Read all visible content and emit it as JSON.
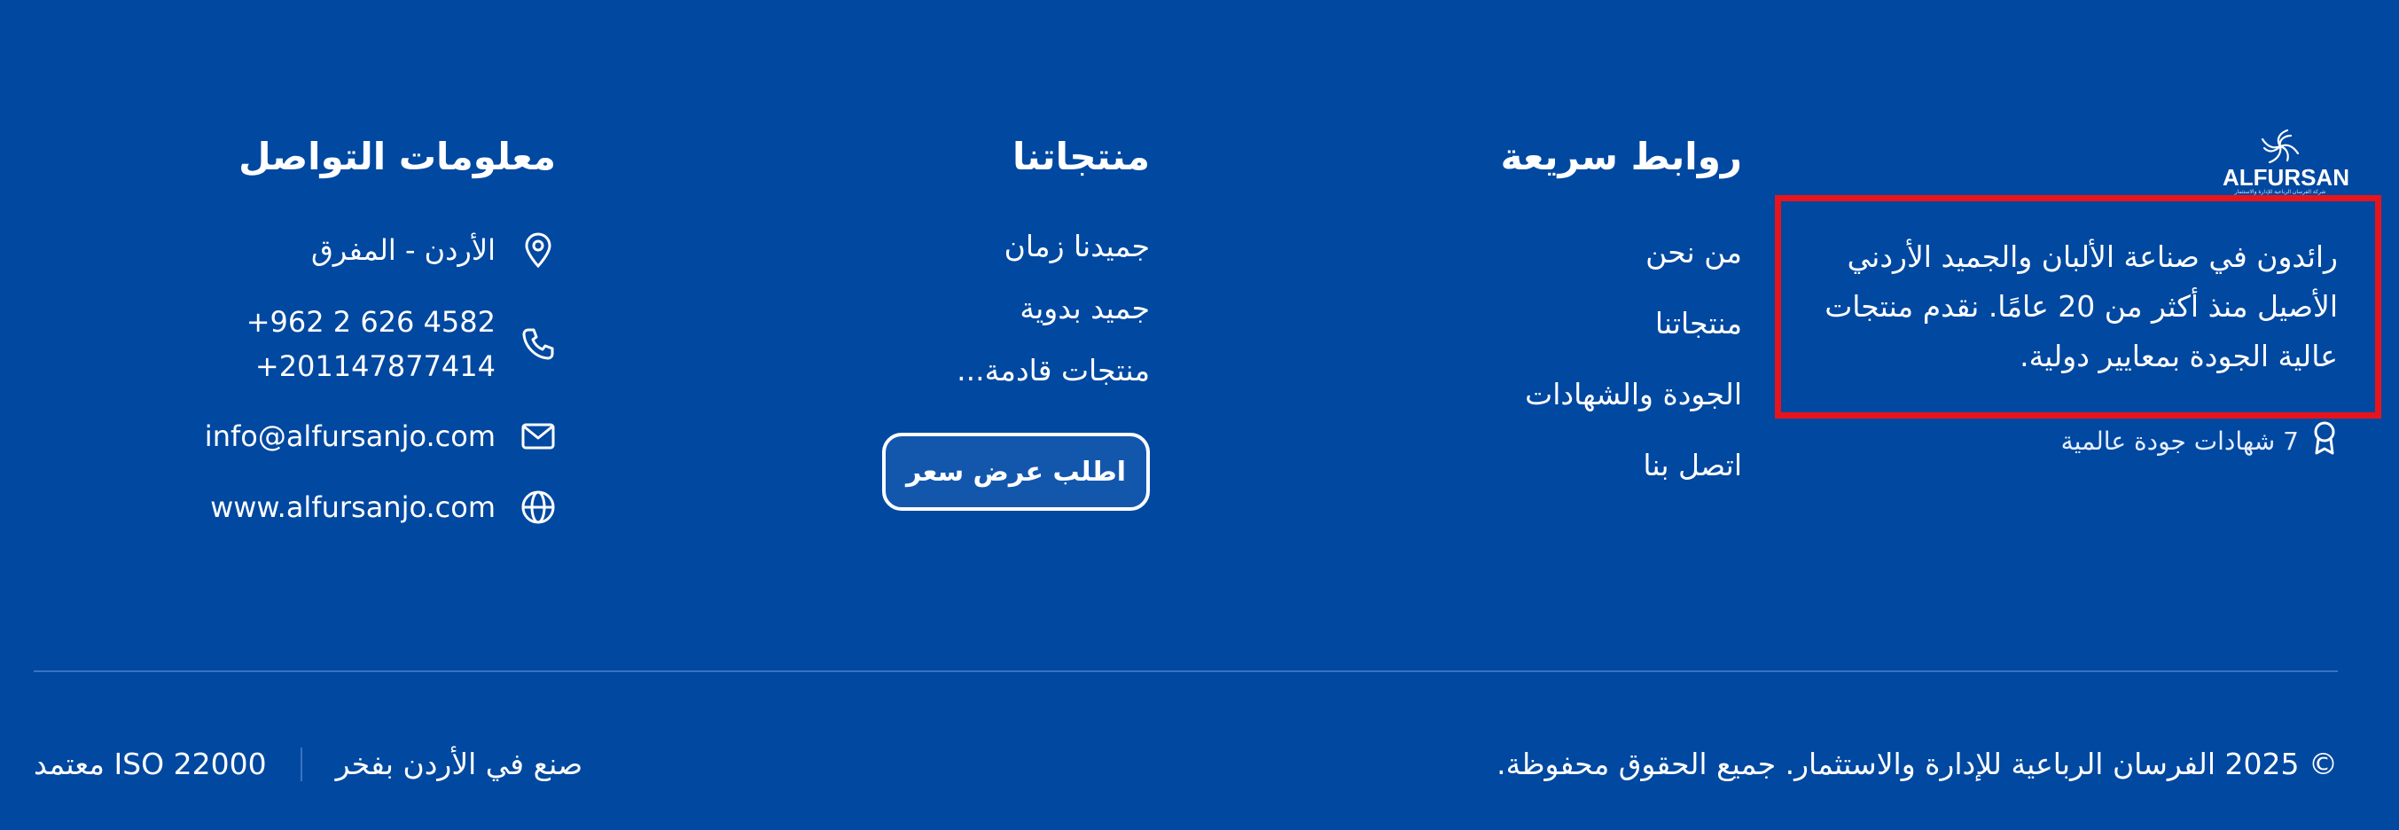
{
  "brand": {
    "logo_text": "ALFURSAN",
    "logo_subtitle": "شركة الفرسان الرباعية للإدارة والاستثمار"
  },
  "about": {
    "text": "رائدون في صناعة الألبان والجميد الأردني الأصيل منذ أكثر من 20 عامًا. نقدم منتجات عالية الجودة بمعايير دولية.",
    "certificates": "7 شهادات جودة عالمية",
    "certificates_icon": "award-icon"
  },
  "quick_links": {
    "title": "روابط سريعة",
    "items": [
      "من نحن",
      "منتجاتنا",
      "الجودة والشهادات",
      "اتصل بنا"
    ]
  },
  "products": {
    "title": "منتجاتنا",
    "items": [
      "جميدنا زمان",
      "جميد بدوية",
      "منتجات قادمة..."
    ],
    "quote_button": "اطلب عرض سعر"
  },
  "contact": {
    "title": "معلومات التواصل",
    "location": "الأردن - المفرق",
    "phone_1": "+962 2 626 4582",
    "phone_2": "+201147877414",
    "email": "info@alfursanjo.com",
    "website": "www.alfursanjo.com",
    "icons": [
      "map-pin-icon",
      "phone-icon",
      "mail-icon",
      "globe-icon"
    ]
  },
  "footer": {
    "copyright": "© 2025 الفرسان الرباعية للإدارة والاستثمار. جميع الحقوق محفوظة.",
    "made_in": "صنع في الأردن بفخر",
    "iso": "ISO 22000 معتمد"
  },
  "colors": {
    "background": "#0048a0",
    "highlight_border": "#e8141c",
    "divider": "#3a74bf"
  }
}
